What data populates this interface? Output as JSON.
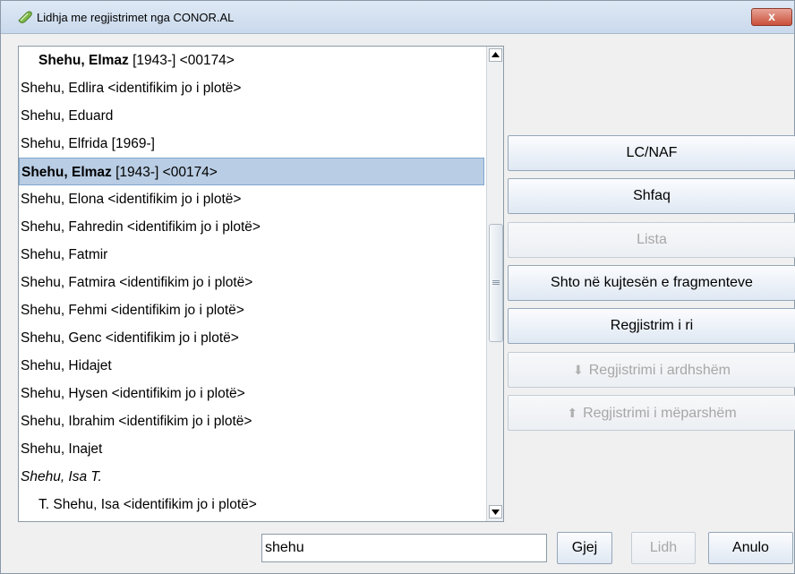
{
  "window": {
    "title": "Lidhja me regjistrimet nga CONOR.AL",
    "close_label": "x"
  },
  "list": {
    "items": [
      {
        "bold": "Shehu, Elmaz",
        "rest": " [1943-] <00174>",
        "indent": true
      },
      {
        "bold": "",
        "rest": "Shehu, Edlira <identifikim jo i plotë>"
      },
      {
        "bold": "",
        "rest": "Shehu, Eduard"
      },
      {
        "bold": "",
        "rest": "Shehu, Elfrida [1969-]"
      },
      {
        "bold": "Shehu, Elmaz",
        "rest": " [1943-] <00174>",
        "selected": true
      },
      {
        "bold": "",
        "rest": "Shehu, Elona <identifikim jo i plotë>"
      },
      {
        "bold": "",
        "rest": "Shehu, Fahredin <identifikim jo i plotë>"
      },
      {
        "bold": "",
        "rest": "Shehu, Fatmir"
      },
      {
        "bold": "",
        "rest": "Shehu, Fatmira <identifikim jo i plotë>"
      },
      {
        "bold": "",
        "rest": "Shehu, Fehmi <identifikim jo i plotë>"
      },
      {
        "bold": "",
        "rest": "Shehu, Genc <identifikim jo i plotë>"
      },
      {
        "bold": "",
        "rest": "Shehu, Hidajet"
      },
      {
        "bold": "",
        "rest": "Shehu, Hysen <identifikim jo i plotë>"
      },
      {
        "bold": "",
        "rest": "Shehu, Ibrahim <identifikim jo i plotë>"
      },
      {
        "bold": "",
        "rest": "Shehu, Inajet"
      },
      {
        "bold": "",
        "rest": "Shehu, Isa T.",
        "italic": true
      },
      {
        "bold": "",
        "rest": "T. Shehu, Isa <identifikim jo i plotë>",
        "indent": true
      }
    ]
  },
  "side_buttons": [
    {
      "label": "LC/NAF",
      "disabled": false
    },
    {
      "label": "Shfaq",
      "disabled": false
    },
    {
      "label": "Lista",
      "disabled": true
    },
    {
      "label": "Shto në kujtesën e fragmenteve",
      "disabled": false
    },
    {
      "label": "Regjistrim i ri",
      "disabled": false
    },
    {
      "label": "Regjistrimi i ardhshëm",
      "disabled": true,
      "icon": "arrow-down-icon"
    },
    {
      "label": "Regjistrimi i mëparshëm",
      "disabled": true,
      "icon": "arrow-up-icon"
    }
  ],
  "search": {
    "value": "shehu"
  },
  "bottom_buttons": {
    "search_label": "Gjej",
    "link_label": "Lidh",
    "cancel_label": "Anulo"
  }
}
